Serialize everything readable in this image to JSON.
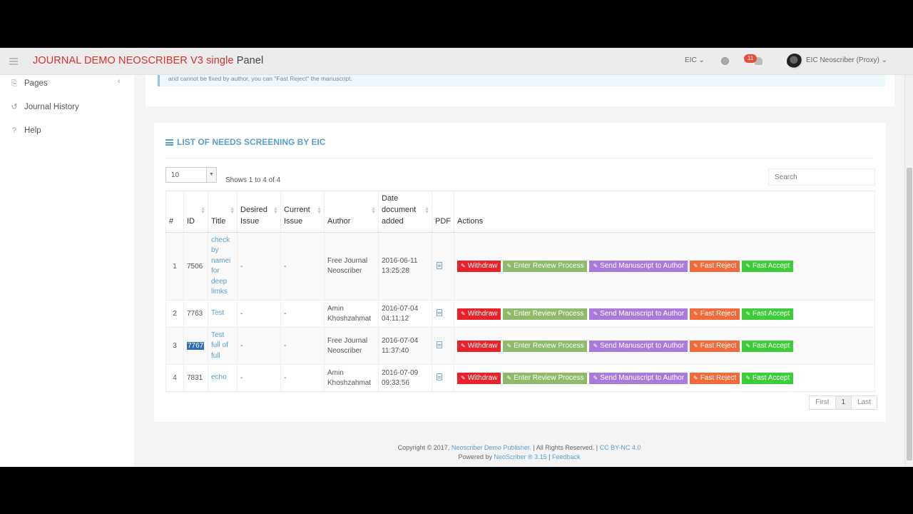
{
  "header": {
    "brand": "JOURNAL DEMO NEOSCRIBER V3 single",
    "panel": "Panel",
    "role": "EIC ⌄",
    "notif_count": "11",
    "user": "EIC Neoscriber (Proxy) ⌄"
  },
  "sidebar": {
    "items": [
      {
        "label": "Pages",
        "icon": "pages-icon"
      },
      {
        "label": "Journal History",
        "icon": "history-icon"
      },
      {
        "label": "Help",
        "icon": "help-icon"
      }
    ]
  },
  "alert": {
    "text": "and cannot be fixed by author, you can \"Fast Reject\" the manuscript."
  },
  "card": {
    "title": "LIST OF NEEDS SCREENING BY EIC",
    "page_length": "10",
    "shows": "Shows 1 to 4 of 4",
    "search_placeholder": "Search"
  },
  "table": {
    "headers": {
      "num": "#",
      "id": "ID",
      "title": "Title",
      "desired": "Desired Issue",
      "current": "Current Issue",
      "author": "Author",
      "date": "Date document added",
      "pdf": "PDF",
      "actions": "Actions"
    },
    "rows": [
      {
        "num": "1",
        "id": "7506",
        "title": "check by namei for deep limks",
        "desired": "-",
        "current": "-",
        "author": "Free Journal Neoscriber",
        "date": "2016-06-11 13:25:28"
      },
      {
        "num": "2",
        "id": "7763",
        "title": "Test",
        "desired": "-",
        "current": "-",
        "author": "Amin Khoshzahmat",
        "date": "2016-07-04 04:11:12"
      },
      {
        "num": "3",
        "id": "7767",
        "title": "Test full of full",
        "desired": "-",
        "current": "-",
        "author": "Free Journal Neoscriber",
        "date": "2016-07-04 11:37:40"
      },
      {
        "num": "4",
        "id": "7831",
        "title": "echo",
        "desired": "-",
        "current": "-",
        "author": "Amin Khoshzahmat",
        "date": "2016-07-09 09:33:56"
      }
    ]
  },
  "actions": {
    "withdraw": "Withdraw",
    "review": "Enter Review Process",
    "send": "Send Manuscript to Author",
    "reject": "Fast Reject",
    "accept": "Fast Accept"
  },
  "pager": {
    "first": "First",
    "page": "1",
    "last": "Last"
  },
  "footer": {
    "copyright": "Copyright © 2017,",
    "publisher": "Neoscriber Demo Publisher.",
    "rights": "| All Rights Reserved. |",
    "license": "CC BY-NC 4.0",
    "powered": "Powered by",
    "engine": "NeoScriber ® 3.15",
    "sep": "|",
    "feedback": "Feedback"
  },
  "colors": {
    "brand": "#d9302a",
    "title": "#5aa0c8",
    "withdraw": "#e8212a",
    "review": "#8dbb6b",
    "send": "#a87ad9",
    "reject": "#f26a3a",
    "accept": "#3fcc3b"
  }
}
